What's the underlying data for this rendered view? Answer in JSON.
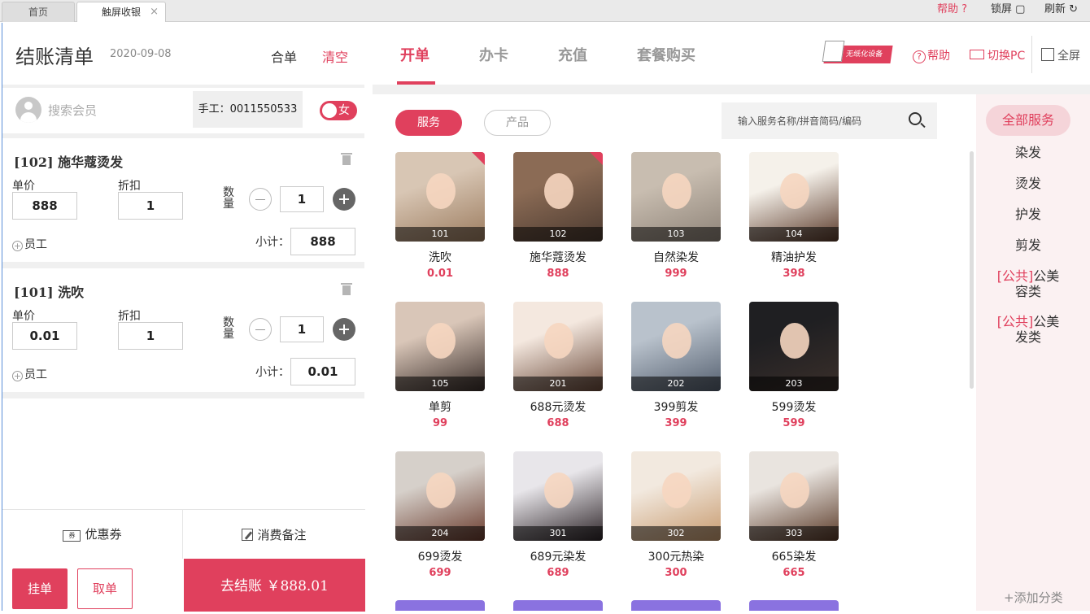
{
  "topbar": {
    "tab_home": "首页",
    "tab_active": "触屏收银",
    "tab_close": "×",
    "help": "帮助",
    "lock": "锁屏",
    "refresh": "刷新"
  },
  "checkout_list": {
    "title": "结账清单",
    "date": "2020-09-08",
    "merge": "合单",
    "clear": "清空"
  },
  "member": {
    "search_placeholder": "搜索会员",
    "manual": "手工：0011550533",
    "gender": "女"
  },
  "labels": {
    "unit_price": "单价",
    "discount": "折扣",
    "qty": "数量",
    "staff": "员工",
    "subtotal": "小计："
  },
  "items": [
    {
      "name": "[102] 施华蔻烫发",
      "price": "888",
      "discount": "1",
      "qty": "1",
      "subtotal": "888"
    },
    {
      "name": "[101] 洗吹",
      "price": "0.01",
      "discount": "1",
      "qty": "1",
      "subtotal": "0.01"
    }
  ],
  "bottom": {
    "coupon": "优惠券",
    "coupon_icon": "券",
    "note": "消费备注",
    "hang": "挂单",
    "take": "取单",
    "checkout": "去结账 ￥888.01"
  },
  "nav": {
    "open": "开单",
    "card": "办卡",
    "charge": "充值",
    "package": "套餐购买"
  },
  "header_tools": {
    "device": "无纸化设备",
    "help": "帮助",
    "switch": "切换PC",
    "fullscreen": "全屏"
  },
  "filter": {
    "service": "服务",
    "product": "产品",
    "search_placeholder": "输入服务名称/拼音简码/编码"
  },
  "products": [
    {
      "code": "101",
      "name": "洗吹",
      "price": "0.01",
      "selected": true,
      "colors": [
        "#d8c6b4",
        "#9c7c5f"
      ]
    },
    {
      "code": "102",
      "name": "施华蔻烫发",
      "price": "888",
      "selected": true,
      "colors": [
        "#8b6b55",
        "#4b3a30"
      ]
    },
    {
      "code": "103",
      "name": "自然染发",
      "price": "999",
      "selected": false,
      "colors": [
        "#c8bdb0",
        "#8e8378"
      ]
    },
    {
      "code": "104",
      "name": "精油护发",
      "price": "398",
      "selected": false,
      "colors": [
        "#f5f1ea",
        "#5b3a2a"
      ]
    },
    {
      "code": "105",
      "name": "单剪",
      "price": "99",
      "selected": false,
      "colors": [
        "#d9c6b8",
        "#3a2e2a"
      ]
    },
    {
      "code": "201",
      "name": "688元烫发",
      "price": "688",
      "selected": false,
      "colors": [
        "#f4e8df",
        "#6b4a3a"
      ]
    },
    {
      "code": "202",
      "name": "399剪发",
      "price": "399",
      "selected": false,
      "colors": [
        "#b9c2cc",
        "#556070"
      ]
    },
    {
      "code": "203",
      "name": "599烫发",
      "price": "599",
      "selected": false,
      "colors": [
        "#1f1f22",
        "#3a2f2a"
      ]
    },
    {
      "code": "204",
      "name": "699烫发",
      "price": "699",
      "selected": false,
      "colors": [
        "#d6d0ca",
        "#6b3c2e"
      ]
    },
    {
      "code": "301",
      "name": "689元染发",
      "price": "689",
      "selected": false,
      "colors": [
        "#e8e6ea",
        "#2d2428"
      ]
    },
    {
      "code": "302",
      "name": "300元热染",
      "price": "300",
      "selected": false,
      "colors": [
        "#f2e9df",
        "#c79a6e"
      ]
    },
    {
      "code": "303",
      "name": "665染发",
      "price": "665",
      "selected": false,
      "colors": [
        "#e9e4df",
        "#5a3a28"
      ]
    }
  ],
  "categories": {
    "all": "全部服务",
    "dye": "染发",
    "perm": "烫发",
    "care": "护发",
    "cut": "剪发",
    "pub_tag": "[公共]",
    "pub1a": "公美",
    "pub1b": "容类",
    "pub2a": "公美",
    "pub2b": "发类",
    "add": "+添加分类"
  },
  "colors": {
    "accent": "#e0405d",
    "tile_bar": "#8a72e0"
  }
}
